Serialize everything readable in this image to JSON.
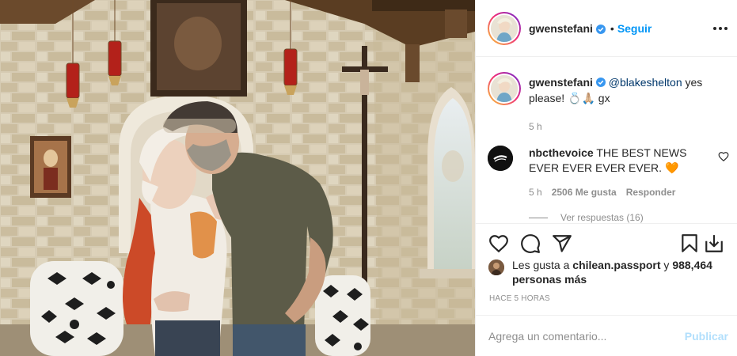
{
  "post": {
    "author": "gwenstefani",
    "follow_label": "Seguir",
    "dot": "•",
    "caption": {
      "author": "gwenstefani",
      "mention": "@blakeshelton",
      "text": " yes please! 💍🙏🏼 gx",
      "time": "5 h"
    },
    "comment": {
      "author": "nbcthevoice",
      "text": " THE BEST NEWS EVER EVER EVER EVER. 🧡",
      "time": "5 h",
      "likes": "2506 Me gusta",
      "reply_label": "Responder",
      "view_replies": "Ver respuestas (16)"
    },
    "likes": {
      "prefix": "Les gusta a ",
      "user": "chilean.passport",
      "middle": " y ",
      "count": "988,464 personas más"
    },
    "posted_ago": "HACE 5 HORAS",
    "add_comment": {
      "placeholder": "Agrega un comentario...",
      "publish_label": "Publicar"
    }
  },
  "icons": {
    "verified": "verified-badge-icon",
    "more": "more-options-icon",
    "like": "heart-icon",
    "comment": "comment-bubble-icon",
    "share": "paper-plane-icon",
    "save": "bookmark-icon",
    "download": "download-icon"
  },
  "colors": {
    "link_blue": "#0095f6",
    "publish_disabled": "#b2dffc",
    "mention": "#00376b",
    "muted": "#8e8e8e",
    "verified": "#3897f0"
  }
}
